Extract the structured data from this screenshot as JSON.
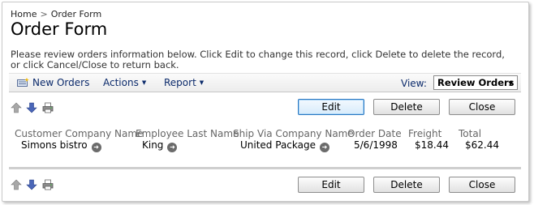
{
  "breadcrumb": {
    "home": "Home",
    "separator": ">",
    "current": "Order Form"
  },
  "page_title": "Order Form",
  "description": "Please review orders information below. Click Edit to change this record, click Delete to delete the record, or click Cancel/Close to return back.",
  "toolbar": {
    "new_orders": "New Orders",
    "actions": "Actions",
    "report": "Report",
    "view_label": "View:",
    "view_value": "Review Orders"
  },
  "buttons": {
    "edit": "Edit",
    "delete": "Delete",
    "close": "Close"
  },
  "record": {
    "headers": [
      "Customer Company Name",
      "Employee Last Name",
      "Ship Via Company Name",
      "Order Date",
      "Freight",
      "Total"
    ],
    "values": [
      "Simons bistro",
      "King",
      "United Package",
      "5/6/1998",
      "$18.44",
      "$62.44"
    ]
  },
  "icons": {
    "move_up": "up-arrow-icon",
    "move_down": "down-arrow-icon",
    "print": "printer-icon",
    "new": "new-record-icon",
    "record_link": "circle-arrow-icon"
  },
  "colors": {
    "toolbar_text": "#0b2a6b",
    "focus_border": "#2a78c2",
    "header_text": "#666666"
  }
}
